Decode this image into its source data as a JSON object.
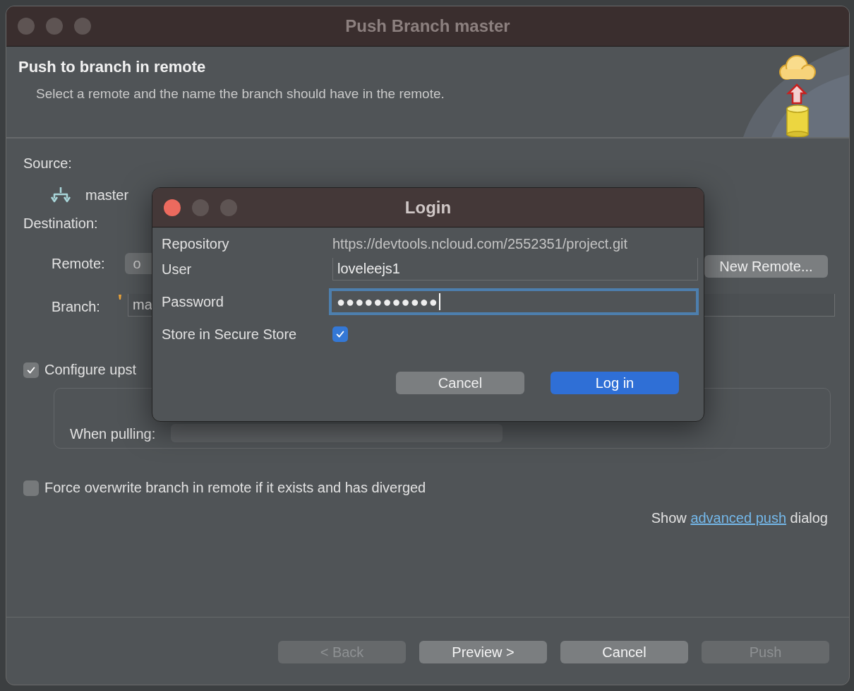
{
  "window": {
    "title": "Push Branch master",
    "focused": false
  },
  "header": {
    "title": "Push to branch in remote",
    "description": "Select a remote and the name the branch should have in the remote."
  },
  "source": {
    "label": "Source:",
    "branch": "master"
  },
  "destination": {
    "label": "Destination:",
    "remote_label": "Remote:",
    "remote_value": "o",
    "new_remote_button": "New Remote...",
    "branch_label": "Branch:",
    "branch_value": "ma"
  },
  "configure_upstream": {
    "label": "Configure upst",
    "checked": true,
    "when_pulling_label": "When pulling:"
  },
  "force_overwrite": {
    "label": "Force overwrite branch in remote if it exists and has diverged",
    "checked": false
  },
  "advanced": {
    "before": "Show",
    "link": "advanced push",
    "after": "dialog"
  },
  "buttons": [
    {
      "label": "< Back",
      "disabled": true
    },
    {
      "label": "Preview >",
      "disabled": false
    },
    {
      "label": "Cancel",
      "disabled": false
    },
    {
      "label": "Push",
      "disabled": true
    }
  ],
  "login": {
    "title": "Login",
    "focused": true,
    "repository": {
      "label": "Repository",
      "value": "https://devtools.ncloud.com/2552351/project.git"
    },
    "user": {
      "label": "User",
      "value": "loveleejs1"
    },
    "password": {
      "label": "Password",
      "value": "●●●●●●●●●●●",
      "focused": true
    },
    "store": {
      "label": "Store in Secure Store",
      "checked": true
    },
    "buttons": [
      {
        "label": "Cancel",
        "default": false
      },
      {
        "label": "Log in",
        "default": true
      }
    ]
  }
}
